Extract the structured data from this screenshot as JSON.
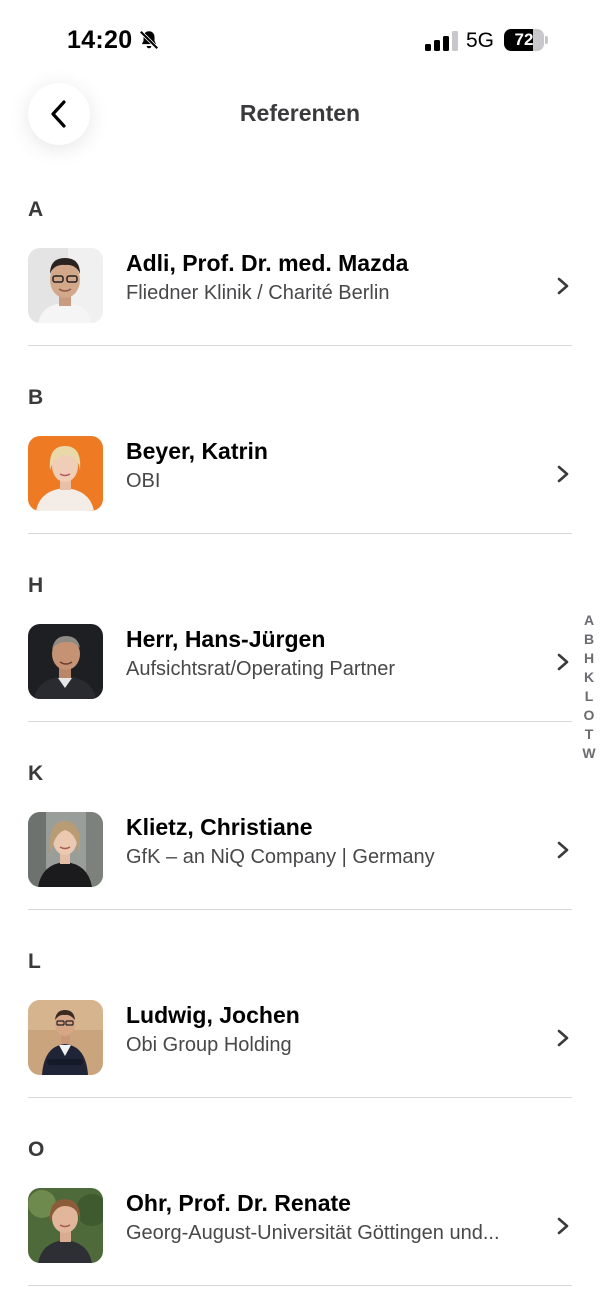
{
  "status_bar": {
    "time": "14:20",
    "network": "5G",
    "battery_level": 72,
    "battery_label": "72"
  },
  "nav": {
    "title": "Referenten",
    "back_icon": "chevron-left-icon"
  },
  "sections": [
    {
      "letter": "A",
      "person": {
        "name": "Adli, Prof. Dr. med. Mazda",
        "affiliation": "Fliedner Klinik / Charité Berlin"
      }
    },
    {
      "letter": "B",
      "person": {
        "name": "Beyer, Katrin",
        "affiliation": "OBI"
      }
    },
    {
      "letter": "H",
      "person": {
        "name": "Herr, Hans-Jürgen",
        "affiliation": "Aufsichtsrat/Operating Partner"
      }
    },
    {
      "letter": "K",
      "person": {
        "name": "Klietz, Christiane",
        "affiliation": "GfK – an NiQ Company | Germany"
      }
    },
    {
      "letter": "L",
      "person": {
        "name": "Ludwig, Jochen",
        "affiliation": "Obi Group Holding"
      }
    },
    {
      "letter": "O",
      "person": {
        "name": "Ohr, Prof. Dr. Renate",
        "affiliation": "Georg-August-Universität Göttingen und..."
      }
    }
  ],
  "alphabet_index": [
    "A",
    "B",
    "H",
    "K",
    "L",
    "O",
    "T",
    "W"
  ]
}
